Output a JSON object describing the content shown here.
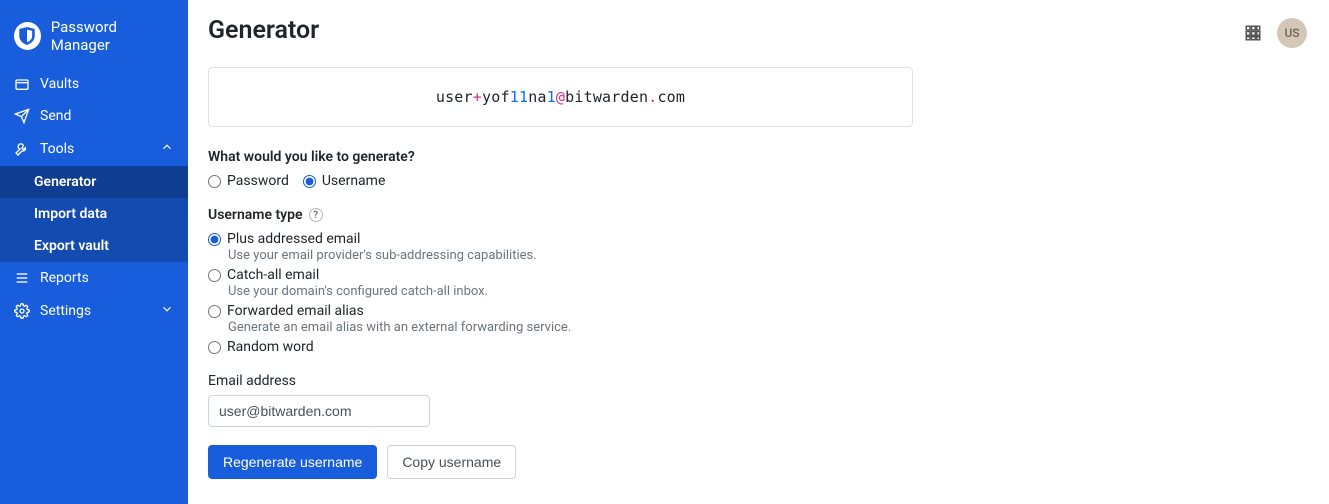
{
  "brand": {
    "name": "Password Manager"
  },
  "sidebar": {
    "items": [
      {
        "label": "Vaults"
      },
      {
        "label": "Send"
      },
      {
        "label": "Tools"
      },
      {
        "label": "Reports"
      },
      {
        "label": "Settings"
      }
    ],
    "tools_sub": [
      {
        "label": "Generator"
      },
      {
        "label": "Import data"
      },
      {
        "label": "Export vault"
      }
    ]
  },
  "header": {
    "title": "Generator",
    "avatar_initials": "US"
  },
  "generator": {
    "output_segments": {
      "s1": "user",
      "plus": "+",
      "s2": "yof",
      "n1": "11",
      "s3": "na",
      "n2": "1",
      "at": "@",
      "s4": "bitwarden",
      "dot": ".",
      "s5": "com"
    },
    "prompt": "What would you like to generate?",
    "type_options": {
      "password": "Password",
      "username": "Username"
    },
    "username_type_label": "Username type",
    "username_types": [
      {
        "label": "Plus addressed email",
        "desc": "Use your email provider's sub-addressing capabilities."
      },
      {
        "label": "Catch-all email",
        "desc": "Use your domain's configured catch-all inbox."
      },
      {
        "label": "Forwarded email alias",
        "desc": "Generate an email alias with an external forwarding service."
      },
      {
        "label": "Random word",
        "desc": ""
      }
    ],
    "email_label": "Email address",
    "email_value": "user@bitwarden.com",
    "buttons": {
      "regenerate": "Regenerate username",
      "copy": "Copy username"
    }
  }
}
